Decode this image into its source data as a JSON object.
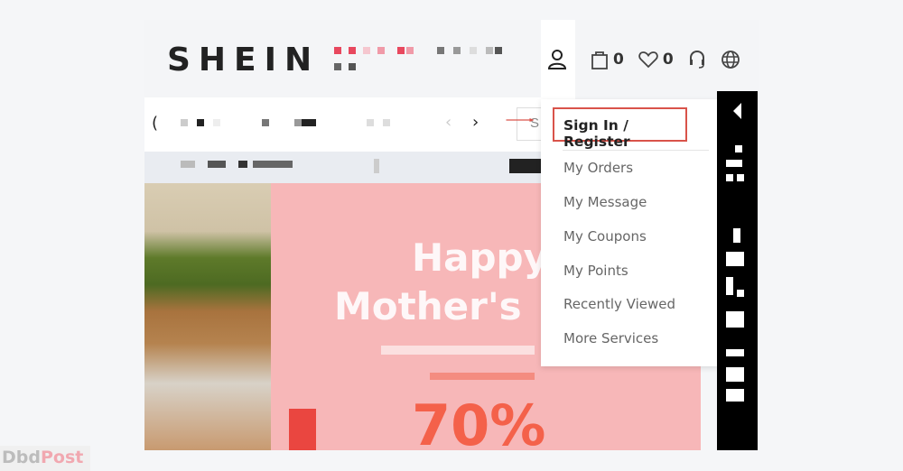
{
  "header": {
    "logo": "SHEIN",
    "cart_count": "0",
    "wishlist_count": "0",
    "icons": [
      "user-icon",
      "shopping-bag-icon",
      "heart-icon",
      "headset-icon",
      "globe-icon"
    ]
  },
  "subnav": {
    "search_placeholder": "S",
    "prev": "‹",
    "next": "›"
  },
  "account_menu": {
    "sign_in": "Sign In / Register",
    "items": [
      {
        "label": "My Orders"
      },
      {
        "label": "My Message"
      },
      {
        "label": "My Coupons"
      },
      {
        "label": "My Points"
      },
      {
        "label": "Recently Viewed"
      },
      {
        "label": "More Services"
      }
    ]
  },
  "banner": {
    "line1": "Happy",
    "line2": "Mother's",
    "percent": "70%"
  },
  "colors": {
    "highlight": "#d9534a",
    "banner_bg": "#f7b7b8",
    "accent_red": "#f4614a"
  },
  "watermark": {
    "part1": "Dbd",
    "part2": "Post"
  }
}
